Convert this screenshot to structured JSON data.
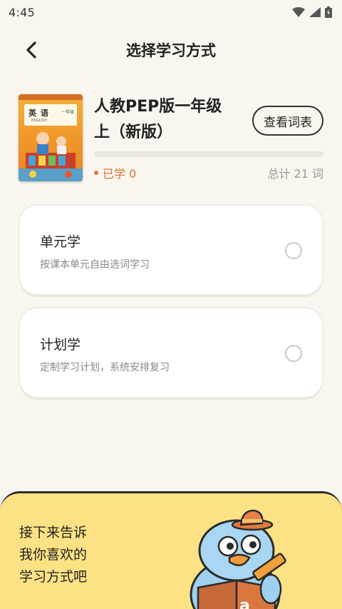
{
  "status_bar": {
    "time": "4:45",
    "icons": [
      "wifi-icon",
      "signal-icon",
      "battery-icon"
    ]
  },
  "header": {
    "back_icon": "chevron-left-icon",
    "title": "选择学习方式"
  },
  "book": {
    "name": "人教PEP版一年级上（新版）",
    "cover": {
      "title": "英 语",
      "subtitle": "ENGLISH",
      "grade": "一年级"
    },
    "view_words_label": "查看词表",
    "progress_fraction": 0,
    "learned_label": "已学 0",
    "total_label": "总计 21 词"
  },
  "options": [
    {
      "title": "单元学",
      "description": "按课本单元自由选词学习",
      "selected": false
    },
    {
      "title": "计划学",
      "description": "定制学习计划，系统安排复习",
      "selected": false
    }
  ],
  "tip": {
    "lines": [
      "接下来告诉",
      "我你喜欢的",
      "学习方式吧"
    ],
    "mascot_icon": "bird-reading-mascot-icon"
  },
  "colors": {
    "background": "#f8f6ee",
    "accent": "#e0733a",
    "panel": "#fde285"
  }
}
